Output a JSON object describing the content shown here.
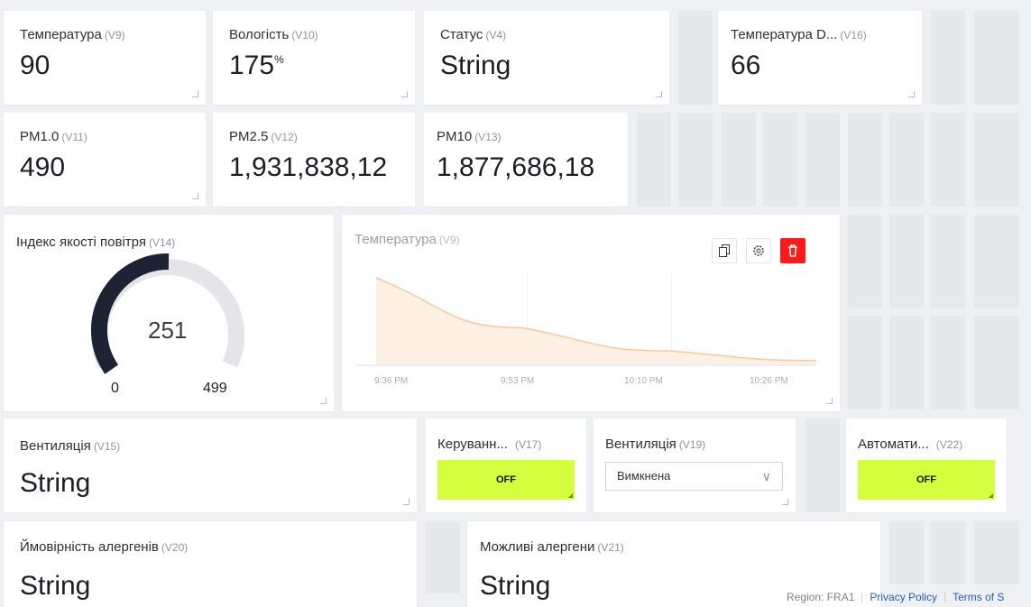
{
  "widgets": {
    "temperature": {
      "title": "Температура",
      "pin": "(V9)",
      "value": "90"
    },
    "humidity": {
      "title": "Вологість",
      "pin": "(V10)",
      "value": "175",
      "unit": "%"
    },
    "status": {
      "title": "Статус",
      "pin": "(V4)",
      "value": "String"
    },
    "temp_d": {
      "title": "Температура D...",
      "pin": "(V16)",
      "value": "66"
    },
    "pm1": {
      "title": "PM1.0",
      "pin": "(V11)",
      "value": "490"
    },
    "pm25": {
      "title": "PM2.5",
      "pin": "(V12)",
      "value": "1,931,838,12"
    },
    "pm10": {
      "title": "PM10",
      "pin": "(V13)",
      "value": "1,877,686,18"
    },
    "aqi": {
      "title": "Індекс якості повітря",
      "pin": "(V14)",
      "value": 251,
      "min": 0,
      "max": 499
    },
    "chart": {
      "title": "Температура",
      "pin": "(V9)"
    },
    "ventilation_str": {
      "title": "Вентиляція",
      "pin": "(V15)",
      "value": "String"
    },
    "control": {
      "title": "Керуванн...",
      "pin": "(V17)",
      "button": "OFF"
    },
    "ventilation_sel": {
      "title": "Вентиляція",
      "pin": "(V19)",
      "selected": "Вимкнена"
    },
    "auto": {
      "title": "Автомати...",
      "pin": "(V22)",
      "button": "OFF"
    },
    "allergen_prob": {
      "title": "Ймовірність алергенів",
      "pin": "(V20)",
      "value": "String"
    },
    "allergens": {
      "title": "Можливі алергени",
      "pin": "(V21)",
      "value": "String"
    }
  },
  "chart_data": {
    "type": "area",
    "x": [
      "9:36 PM",
      "9:53 PM",
      "10:10 PM",
      "10:26 PM"
    ],
    "series": [
      {
        "values": [
          90,
          38,
          14,
          4
        ]
      }
    ],
    "color": "#f9c89a"
  },
  "colors": {
    "gauge_fill": "#1c2333",
    "gauge_track": "#e3e5e8",
    "button_bg": "#d4ff3f",
    "delete_bg": "#ff1a1a"
  },
  "icons": {
    "copy": "copy-icon",
    "settings": "gear-icon",
    "delete": "trash-icon"
  },
  "footer": {
    "region": "Region: FRA1",
    "privacy": "Privacy Policy",
    "terms": "Terms of S"
  }
}
